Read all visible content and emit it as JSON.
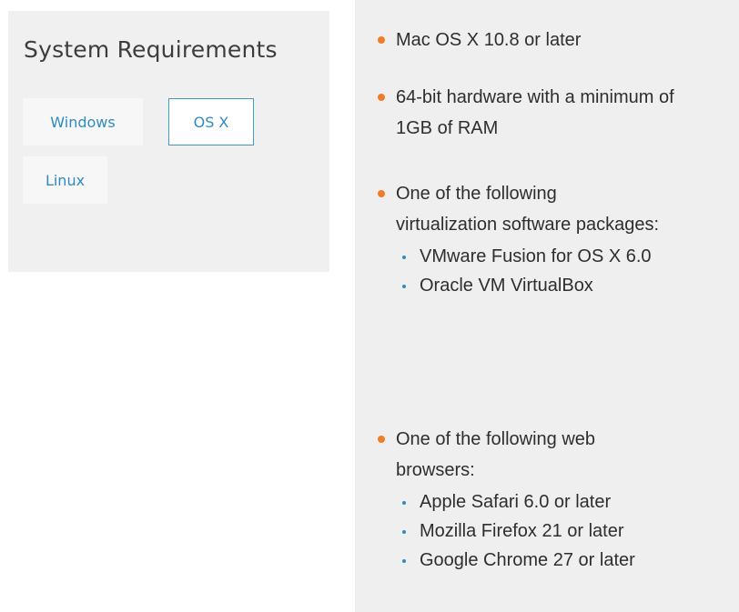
{
  "sidebar": {
    "title": "System Requirements",
    "tabs": [
      {
        "label": "Windows",
        "active": false
      },
      {
        "label": "OS X",
        "active": true
      },
      {
        "label": "Linux",
        "active": false
      }
    ]
  },
  "requirements": {
    "items": [
      {
        "text": "Mac OS X 10.8 or later"
      },
      {
        "text": "64-bit hardware with a minimum of 1GB of RAM"
      },
      {
        "text": "One of the following virtualization software packages:",
        "sub_items": [
          "VMware Fusion for OS X 6.0",
          "Oracle VM VirtualBox"
        ]
      },
      {
        "text": "One of the following web browsers:",
        "sub_items": [
          "Apple Safari 6.0 or later",
          "Mozilla Firefox 21 or later",
          "Google Chrome 27 or later"
        ]
      }
    ]
  },
  "colors": {
    "accent_blue": "#2f8bc0",
    "bullet_orange": "#f07d2a",
    "panel_gray": "#efefef",
    "card_gray": "#f0f0f0"
  }
}
